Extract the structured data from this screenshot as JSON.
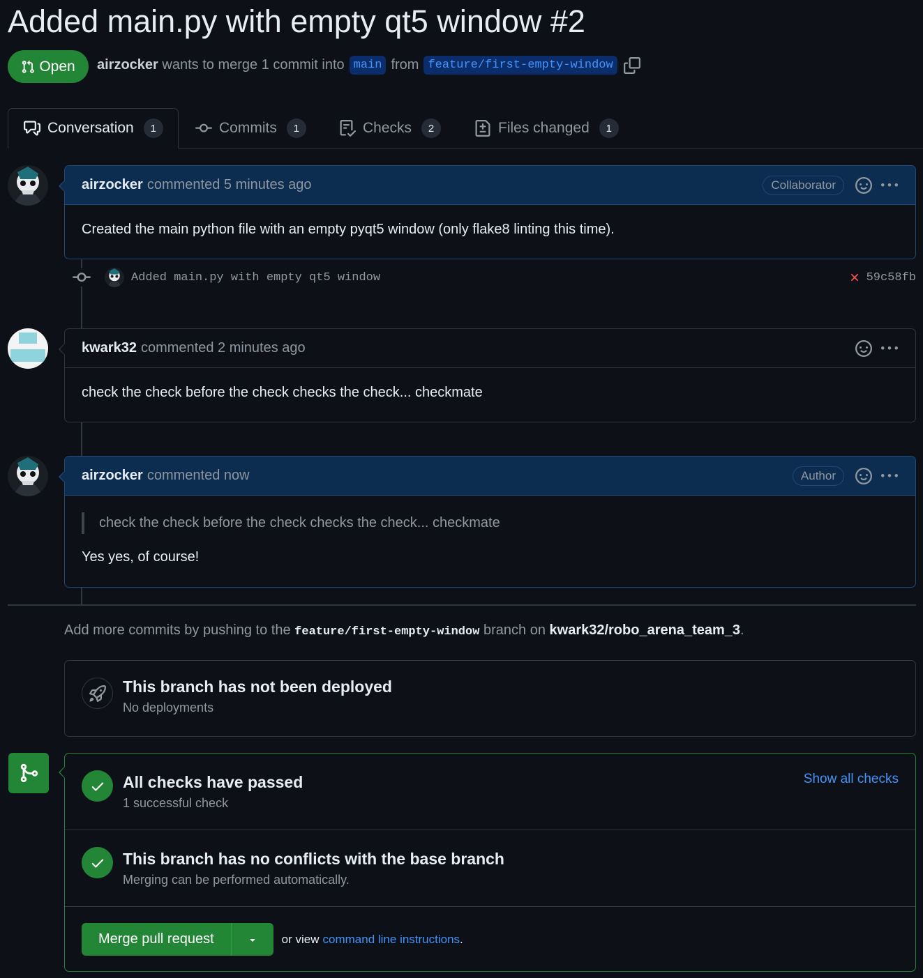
{
  "pr": {
    "title": "Added main.py with empty qt5 window #2",
    "state": "Open",
    "author": "airzocker",
    "merge_text": "wants to merge 1 commit into",
    "base_branch": "main",
    "from_text": "from",
    "head_branch": "feature/first-empty-window"
  },
  "tabs": [
    {
      "label": "Conversation",
      "count": "1",
      "icon": "comment-discussion-icon"
    },
    {
      "label": "Commits",
      "count": "1",
      "icon": "git-commit-icon"
    },
    {
      "label": "Checks",
      "count": "2",
      "icon": "checklist-icon"
    },
    {
      "label": "Files changed",
      "count": "1",
      "icon": "file-diff-icon"
    }
  ],
  "comments": [
    {
      "author": "airzocker",
      "meta": "commented 5 minutes ago",
      "role": "Collaborator",
      "body": "Created the main python file with an empty pyqt5 window (only flake8 linting this time)."
    },
    {
      "author": "kwark32",
      "meta": "commented 2 minutes ago",
      "role": "",
      "body": "check the check before the check checks the check... checkmate"
    },
    {
      "author": "airzocker",
      "meta": "commented now",
      "role": "Author",
      "quote": "check the check before the check checks the check... checkmate",
      "body": "Yes yes, of course!"
    }
  ],
  "commit": {
    "message": "Added main.py with empty qt5 window",
    "sha": "59c58fb",
    "status_color": "#f85149"
  },
  "push_info": {
    "prefix": "Add more commits by pushing to the",
    "branch": "feature/first-empty-window",
    "middle": "branch on",
    "repo": "kwark32/robo_arena_team_3",
    "suffix": "."
  },
  "deploy": {
    "title": "This branch has not been deployed",
    "subtitle": "No deployments"
  },
  "checks": {
    "title": "All checks have passed",
    "subtitle": "1 successful check",
    "link": "Show all checks"
  },
  "conflicts": {
    "title": "This branch has no conflicts with the base branch",
    "subtitle": "Merging can be performed automatically."
  },
  "merge": {
    "button": "Merge pull request",
    "or_text": "or view",
    "link": "command line instructions",
    "suffix": "."
  },
  "colors": {
    "accent_green": "#238636",
    "link_blue": "#4493f8",
    "background": "#0d1117"
  }
}
